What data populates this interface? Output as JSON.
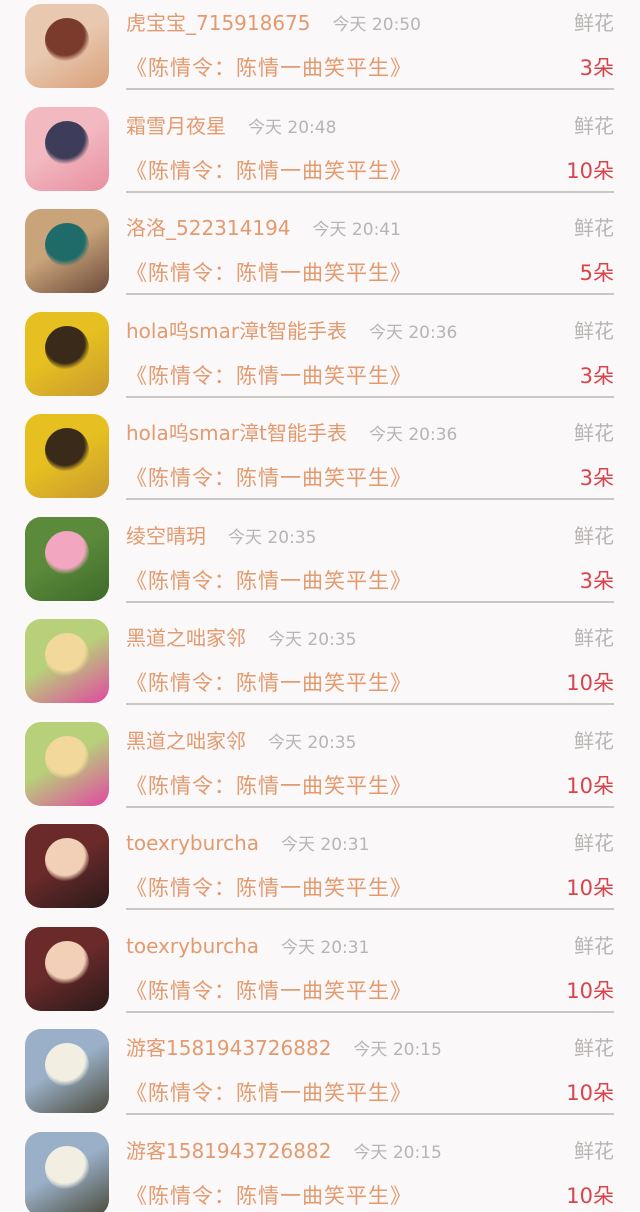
{
  "gift_label": "鲜花",
  "work_title": "《陈情令：陈情一曲笑平生》",
  "rows": [
    {
      "name": "虎宝宝_715918675",
      "time": "今天 20:50",
      "count": "3朵",
      "avatar_colors": [
        "#e8c9b0",
        "#7a3b2c",
        "#d9a07a"
      ]
    },
    {
      "name": "霜雪月夜星",
      "time": "今天 20:48",
      "count": "10朵",
      "avatar_colors": [
        "#f2b9c0",
        "#3d3d5a",
        "#e88fa0"
      ]
    },
    {
      "name": "洛洛_522314194",
      "time": "今天 20:41",
      "count": "5朵",
      "avatar_colors": [
        "#c9a37a",
        "#1f6b6a",
        "#6b4a3a"
      ]
    },
    {
      "name": "hola呜smar漳t智能手表",
      "time": "今天 20:36",
      "count": "3朵",
      "avatar_colors": [
        "#e6c020",
        "#3a2a1a",
        "#c89a30"
      ]
    },
    {
      "name": "hola呜smar漳t智能手表",
      "time": "今天 20:36",
      "count": "3朵",
      "avatar_colors": [
        "#e6c020",
        "#3a2a1a",
        "#c89a30"
      ]
    },
    {
      "name": "绫空晴玥",
      "time": "今天 20:35",
      "count": "3朵",
      "avatar_colors": [
        "#5a8a3a",
        "#f2a6c0",
        "#3f6a2a"
      ]
    },
    {
      "name": "黑道之咄家邻",
      "time": "今天 20:35",
      "count": "10朵",
      "avatar_colors": [
        "#b8d07a",
        "#f2d89a",
        "#e048a0"
      ]
    },
    {
      "name": "黑道之咄家邻",
      "time": "今天 20:35",
      "count": "10朵",
      "avatar_colors": [
        "#b8d07a",
        "#f2d89a",
        "#e048a0"
      ]
    },
    {
      "name": "toexryburcha",
      "time": "今天 20:31",
      "count": "10朵",
      "avatar_colors": [
        "#6a2a2a",
        "#f2d0b8",
        "#2a1a1a"
      ]
    },
    {
      "name": "toexryburcha",
      "time": "今天 20:31",
      "count": "10朵",
      "avatar_colors": [
        "#6a2a2a",
        "#f2d0b8",
        "#2a1a1a"
      ]
    },
    {
      "name": "游客1581943726882",
      "time": "今天 20:15",
      "count": "10朵",
      "avatar_colors": [
        "#9ab0c8",
        "#f2efe2",
        "#4a4a3a"
      ]
    },
    {
      "name": "游客1581943726882",
      "time": "今天 20:15",
      "count": "10朵",
      "avatar_colors": [
        "#9ab0c8",
        "#f2efe2",
        "#4a4a3a"
      ]
    }
  ]
}
